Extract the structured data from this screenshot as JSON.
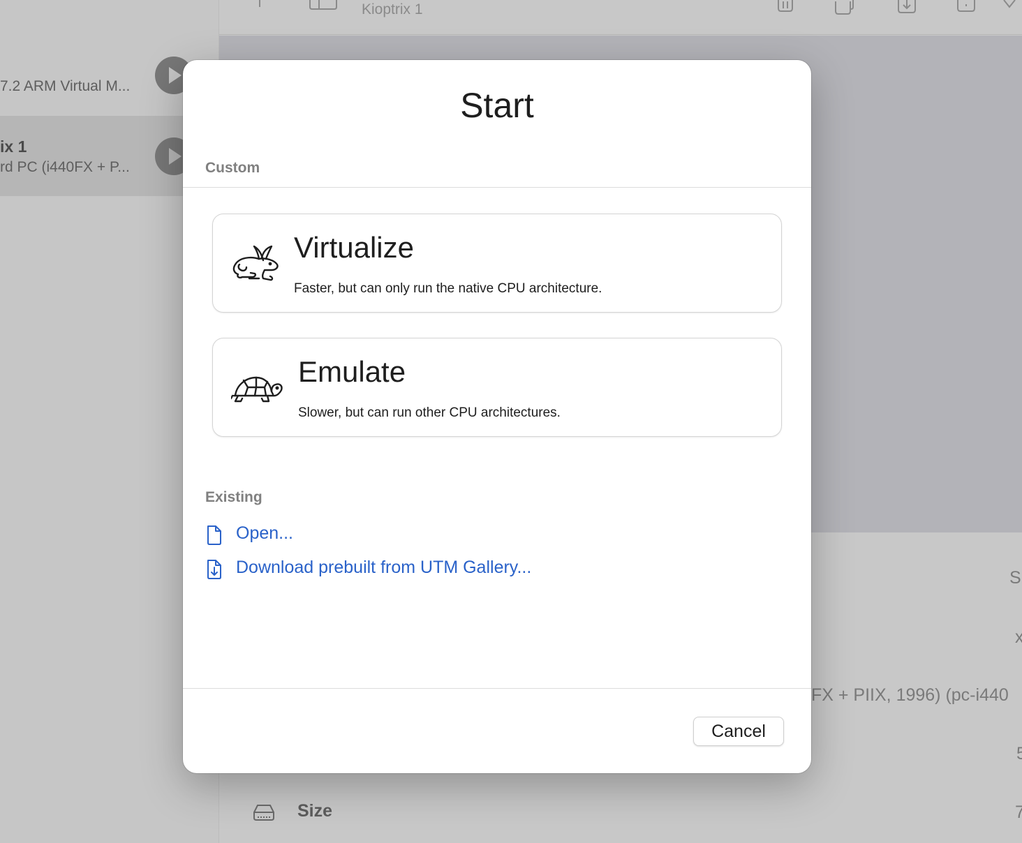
{
  "background": {
    "sidebar": {
      "items": [
        {
          "title": "",
          "subtitle": "7.2 ARM Virtual M..."
        },
        {
          "title": "ix 1",
          "subtitle": "rd PC (i440FX + P..."
        }
      ]
    },
    "toolbar": {
      "title": "Kioptrix 1"
    },
    "details": {
      "right_s": "S",
      "right_x": "x",
      "machine_text": "FX + PIIX, 1996) (pc-i440",
      "right_5": "5",
      "size_label": "Size",
      "right_7": "7"
    }
  },
  "modal": {
    "title": "Start",
    "custom_label": "Custom",
    "options": [
      {
        "title": "Virtualize",
        "description": "Faster, but can only run the native CPU architecture.",
        "icon": "rabbit-icon"
      },
      {
        "title": "Emulate",
        "description": "Slower, but can run other CPU architectures.",
        "icon": "turtle-icon"
      }
    ],
    "existing_label": "Existing",
    "links": [
      {
        "label": "Open...",
        "icon": "document-icon"
      },
      {
        "label": "Download prebuilt from UTM Gallery...",
        "icon": "document-download-icon"
      }
    ],
    "cancel_label": "Cancel"
  },
  "colors": {
    "link": "#2a62c9",
    "dim_background": "#c9c9c9",
    "modal_background": "#ffffff"
  }
}
